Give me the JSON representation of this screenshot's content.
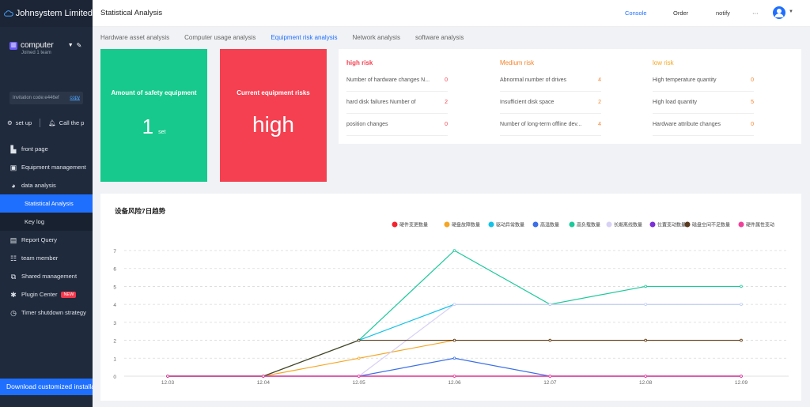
{
  "app": {
    "name": "Johnsystem Limited"
  },
  "team": {
    "name": "computer",
    "joined": "Joined 1 team",
    "invite": "Invitation code:e446ef",
    "copy": "copy"
  },
  "tools": {
    "setup": "set up",
    "call": "Call the p"
  },
  "menu": [
    {
      "label": "front page",
      "icon": "home-icon"
    },
    {
      "label": "Equipment management",
      "icon": "device-icon"
    },
    {
      "label": "data analysis",
      "icon": "pie-chart-icon"
    },
    {
      "label": "Statistical Analysis",
      "sub": true,
      "active": true
    },
    {
      "label": "Key log",
      "sub": true
    },
    {
      "label": "Report Query",
      "icon": "report-icon"
    },
    {
      "label": "team member",
      "icon": "team-icon"
    },
    {
      "label": "Shared management",
      "icon": "share-icon"
    },
    {
      "label": "Plugin Center",
      "icon": "plugin-icon",
      "badge": "NEW"
    },
    {
      "label": "Timer shutdown strategy",
      "icon": "timer-icon"
    }
  ],
  "download": "Download customized installatio",
  "header": {
    "title": "Statistical Analysis",
    "console": "Console",
    "order": "Order",
    "notify": "notify",
    "more": "···"
  },
  "tabs": [
    "Hardware asset analysis",
    "Computer usage analysis",
    "Equipment risk analysis",
    "Network analysis",
    "software analysis"
  ],
  "active_tab": 2,
  "cards": {
    "safety": {
      "title": "Amount of safety equipment",
      "value": "1",
      "unit": "set"
    },
    "risk": {
      "title": "Current equipment risks",
      "value": "high"
    }
  },
  "risk_groups": [
    {
      "title": "high risk",
      "color": "#f44050",
      "items": [
        {
          "label": "Number of hardware changes N...",
          "value": "0"
        },
        {
          "label": "hard disk failures Number of",
          "value": "2"
        },
        {
          "label": "position changes",
          "value": "0"
        }
      ]
    },
    {
      "title": "Medium risk",
      "color": "#f5822a",
      "items": [
        {
          "label": "Abnormal number of drives",
          "value": "4"
        },
        {
          "label": "Insufficient disk space",
          "value": "2"
        },
        {
          "label": "Number of long-term offline dev...",
          "value": "4"
        }
      ]
    },
    {
      "title": "low risk",
      "color": "#f5a623",
      "items": [
        {
          "label": "High temperature quantity",
          "value": "0"
        },
        {
          "label": "High load quantity",
          "value": "5"
        },
        {
          "label": "Hardware attribute changes",
          "value": "0"
        }
      ]
    }
  ],
  "chart_data": {
    "type": "line",
    "title": "设备风险7日趋势",
    "categories": [
      "12.03",
      "12.04",
      "12.05",
      "12.06",
      "12.07",
      "12.08",
      "12.09"
    ],
    "ylim": [
      0,
      7
    ],
    "yticks": [
      0,
      1,
      2,
      3,
      4,
      5,
      6,
      7
    ],
    "grid": true,
    "legend": "top-right",
    "series": [
      {
        "name": "硬件变更数量",
        "color": "#f5222d",
        "values": [
          0,
          0,
          0,
          0,
          0,
          0,
          0
        ]
      },
      {
        "name": "硬盘故障数量",
        "color": "#f5a623",
        "values": [
          0,
          0,
          1,
          2,
          2,
          2,
          2
        ]
      },
      {
        "name": "驱动异常数量",
        "color": "#13c2e8",
        "values": [
          0,
          0,
          2,
          4,
          4,
          4,
          4
        ]
      },
      {
        "name": "高温数量",
        "color": "#3b6fe8",
        "values": [
          0,
          0,
          0,
          1,
          0,
          0,
          0
        ]
      },
      {
        "name": "高负载数量",
        "color": "#1dc99a",
        "values": [
          0,
          0,
          2,
          7,
          4,
          5,
          5
        ]
      },
      {
        "name": "长期离线数量",
        "color": "#d8d0f5",
        "values": [
          0,
          0,
          0,
          4,
          4,
          4,
          4
        ]
      },
      {
        "name": "位置变动数量",
        "color": "#7b2fd6",
        "values": [
          0,
          0,
          0,
          0,
          0,
          0,
          0
        ]
      },
      {
        "name": "磁盘空间不足数量",
        "color": "#5a3a1c",
        "values": [
          0,
          0,
          2,
          2,
          2,
          2,
          2
        ]
      },
      {
        "name": "硬件属性变动",
        "color": "#f0409a",
        "values": [
          0,
          0,
          0,
          0,
          0,
          0,
          0
        ]
      }
    ]
  }
}
